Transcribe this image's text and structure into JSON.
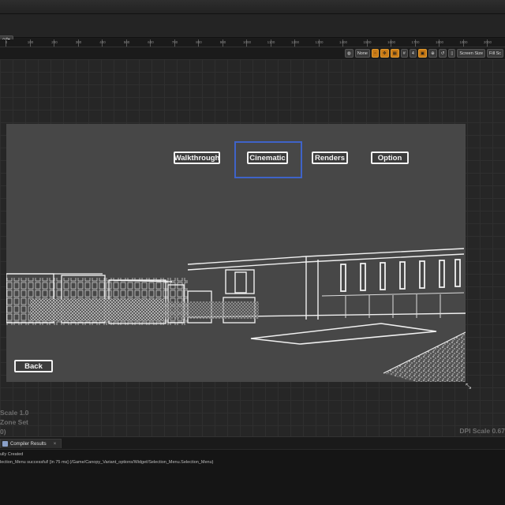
{
  "toolbar": {
    "dropdown_label": "ed"
  },
  "ruler": {
    "labels": [
      "0",
      "100",
      "200",
      "300",
      "400",
      "500",
      "600",
      "700",
      "800",
      "900",
      "1000",
      "1100",
      "1200",
      "1300",
      "1400",
      "1500",
      "1600",
      "1700",
      "1800",
      "1900",
      "2000"
    ]
  },
  "viewport_toolbar": {
    "none_label": "None",
    "scale_value": "4",
    "screen_size_label": "Screen Size",
    "fill_label": "Fill Sc"
  },
  "menu": {
    "walkthrough": "Walkthrough",
    "cinematic": "Cinematic",
    "renders": "Renders",
    "option": "Option",
    "back": "Back"
  },
  "info": {
    "scale": "Scale 1.0",
    "zone": "Zone Set",
    "paren": "0)",
    "dpi": "DPI Scale 0.67"
  },
  "bottom": {
    "tab_label": "Compiler Results",
    "log_line_1": "ully Created",
    "log_line_2": "lection_Menu successful! [in 75 ms] (/Game/Canopy_Variant_options/Widget/Selection_Menu.Selection_Menu)"
  },
  "colors": {
    "accent_orange": "#c87a16",
    "selection_blue": "#3f63c8",
    "viewport_bg": "#474747"
  }
}
